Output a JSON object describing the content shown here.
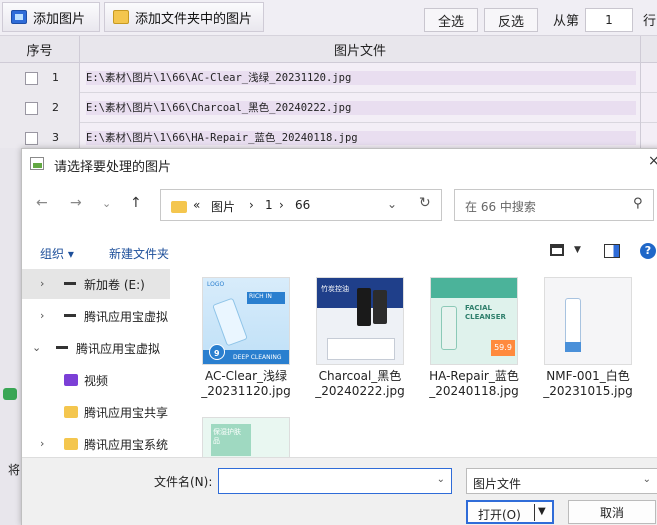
{
  "toolbar": {
    "add_images": "添加图片",
    "add_folder_images": "添加文件夹中的图片",
    "select_all": "全选",
    "invert_select": "反选",
    "from_label": "从第",
    "from_value": "1",
    "row_label": "行"
  },
  "table": {
    "headers": [
      "序号",
      "图片文件"
    ],
    "rows": [
      {
        "num": "1",
        "path": "E:\\素材\\图片\\1\\66\\AC-Clear_浅绿_20231120.jpg"
      },
      {
        "num": "2",
        "path": "E:\\素材\\图片\\1\\66\\Charcoal_黑色_20240222.jpg"
      },
      {
        "num": "3",
        "path": "E:\\素材\\图片\\1\\66\\HA-Repair_蓝色_20240118.jpg"
      }
    ]
  },
  "background_misc": {
    "left_text": "将"
  },
  "dialog": {
    "title": "请选择要处理的图片",
    "close": "×",
    "breadcrumb": [
      "«",
      "图片",
      "›",
      "1",
      "›",
      "66"
    ],
    "search_placeholder": "在 66 中搜索",
    "organize": "组织 ▾",
    "new_folder": "新建文件夹",
    "tree": [
      {
        "label": "新加卷 (E:)",
        "chev": "›",
        "icon": "drive-icon",
        "selected": true
      },
      {
        "label": "腾讯应用宝虚拟",
        "chev": "›",
        "icon": "drive-icon"
      },
      {
        "label": "腾讯应用宝虚拟",
        "chev": "⌄",
        "icon": "drive-icon"
      },
      {
        "label": "视频",
        "chev": "",
        "icon": "video-icon"
      },
      {
        "label": "腾讯应用宝共享",
        "chev": "",
        "icon": "folder-icon"
      },
      {
        "label": "腾讯应用宝系统",
        "chev": "›",
        "icon": "folder-icon"
      }
    ],
    "files": [
      {
        "name": "AC-Clear_浅绿\n_20231120.jpg"
      },
      {
        "name": "Charcoal_黑色\n_20240222.jpg"
      },
      {
        "name": "HA-Repair_蓝色\n_20240118.jpg"
      },
      {
        "name": "NMF-001_白色\n_20231015.jpg"
      },
      {
        "name": ""
      }
    ],
    "thumb_text": {
      "t1_top": "LOGO",
      "t1_mid": "RICH IN",
      "t1_bottom": "DEEP CLEANING",
      "t1_badge": "9",
      "t3_mid": "FACIAL CLEANSER",
      "t3_price": "59.9",
      "t2_top": "竹炭控油",
      "t5_top": "保湿护肤品"
    },
    "filename_label": "文件名(N):",
    "filename_value": "",
    "filetype_value": "图片文件",
    "open_label": "打开(O)",
    "cancel_label": "取消"
  }
}
